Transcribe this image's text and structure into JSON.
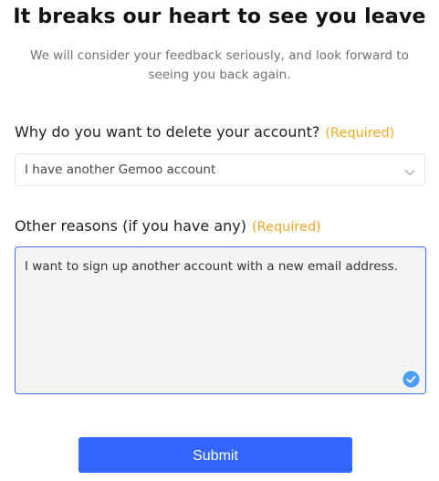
{
  "page": {
    "title": "It breaks our heart to see you leave",
    "subtitle": "We will consider your feedback seriously, and look forward to seeing you back again."
  },
  "form": {
    "reason_question": {
      "label": "Why do you want to delete your account?",
      "required_tag": "(Required)",
      "selected_value": "I have another Gemoo account",
      "icon": "chevron-down-icon"
    },
    "other_reasons": {
      "label": "Other reasons (if you have any)",
      "required_tag": "(Required)",
      "value": "I want to sign up another account with a new email address.",
      "icon": "check-circle-icon"
    },
    "submit_label": "Submit"
  },
  "colors": {
    "required": "#f5a623",
    "accent": "#3366ff",
    "textarea_border": "#3d6ff2",
    "check_badge": "#4a9eff"
  }
}
